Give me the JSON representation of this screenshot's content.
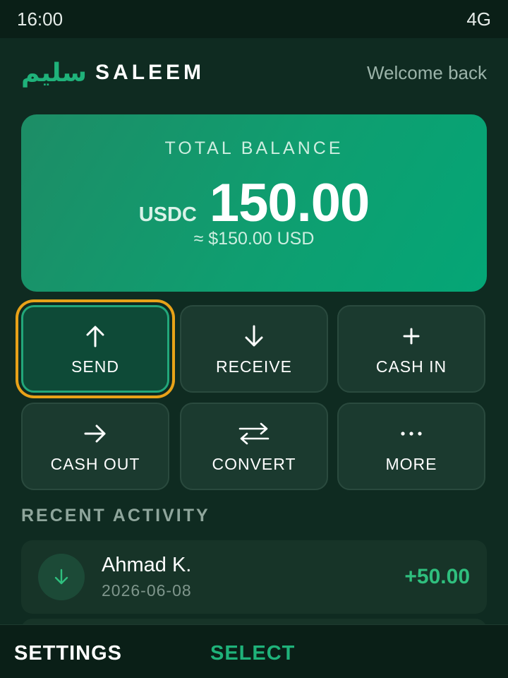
{
  "status_bar": {
    "time": "16:00",
    "network": "4G"
  },
  "header": {
    "brand_arabic": "سليم",
    "brand_name": "SALEEM",
    "welcome": "Welcome back"
  },
  "balance": {
    "label": "TOTAL BALANCE",
    "currency": "USDC",
    "amount": "150.00",
    "usd_equivalent": "≈ $150.00 USD"
  },
  "actions": [
    {
      "label": "SEND",
      "icon": "arrow-up-icon",
      "focused": true
    },
    {
      "label": "RECEIVE",
      "icon": "arrow-down-icon"
    },
    {
      "label": "CASH IN",
      "icon": "plus-icon"
    },
    {
      "label": "CASH OUT",
      "icon": "arrow-right-icon"
    },
    {
      "label": "CONVERT",
      "icon": "swap-arrows-icon"
    },
    {
      "label": "MORE",
      "icon": "more-dots-icon"
    }
  ],
  "recent_activity": {
    "title": "RECENT ACTIVITY",
    "items": [
      {
        "name": "Ahmad K.",
        "date": "2026-06-08",
        "amount": "+50.00",
        "icon": "arrow-down-icon"
      }
    ]
  },
  "softkeys": {
    "left": "SETTINGS",
    "center": "SELECT"
  },
  "colors": {
    "accent": "#1fb27a",
    "focus_ring": "#e8a218",
    "background": "#0f2b21",
    "positive_amount": "#2fbf7e"
  }
}
